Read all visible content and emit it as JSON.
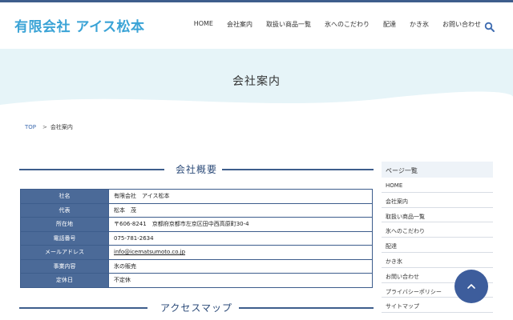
{
  "header": {
    "logo": "有限会社 アイス松本",
    "nav": [
      "HOME",
      "会社案内",
      "取扱い商品一覧",
      "氷へのこだわり",
      "配達",
      "かき氷",
      "お問い合わせ"
    ],
    "search_icon": "search-icon"
  },
  "hero": {
    "title": "会社案内"
  },
  "breadcrumb": {
    "home": "TOP",
    "separator": ">",
    "current": "会社案内"
  },
  "sections": {
    "overview": "会社概要",
    "access": "アクセスマップ"
  },
  "company": {
    "rows": [
      {
        "label": "社名",
        "value": "有限会社　アイス松本"
      },
      {
        "label": "代表",
        "value": "松本　茂"
      },
      {
        "label": "所在地",
        "value": "〒606-8241　京都府京都市左京区田中西高原町30-4"
      },
      {
        "label": "電話番号",
        "value": "075-781-2634"
      },
      {
        "label": "メールアドレス",
        "value": "info@icematsumoto.co.jp"
      },
      {
        "label": "事業内容",
        "value": "氷の販売"
      },
      {
        "label": "定休日",
        "value": "不定休"
      }
    ]
  },
  "sidebar": {
    "title": "ページ一覧",
    "items": [
      "HOME",
      "会社案内",
      "取扱い商品一覧",
      "氷へのこだわり",
      "配達",
      "かき氷",
      "お問い合わせ",
      "プライバシーポリシー",
      "サイトマップ"
    ]
  },
  "colors": {
    "accent": "#3d5d8c",
    "logo": "#3aa3d6",
    "hero_bg": "#e6f4f8",
    "table_header": "#4b6a98"
  },
  "back_to_top_icon": "chevron-up-icon"
}
